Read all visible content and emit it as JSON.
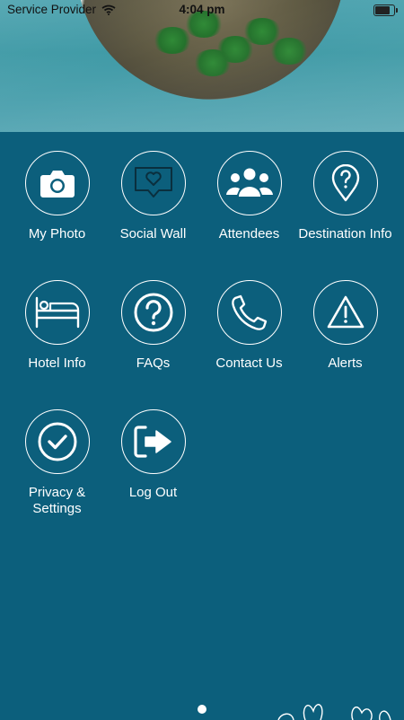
{
  "status_bar": {
    "carrier": "Service Provider",
    "time": "4:04 pm",
    "battery_level": 0.9
  },
  "hero": {
    "image": "tropical-island-aerial"
  },
  "menu": [
    {
      "label": "My Photo",
      "icon": "camera-icon"
    },
    {
      "label": "Social Wall",
      "icon": "speech-heart-icon"
    },
    {
      "label": "Attendees",
      "icon": "people-group-icon"
    },
    {
      "label": "Destination Info",
      "icon": "map-pin-question-icon"
    },
    {
      "label": "Hotel Info",
      "icon": "bed-icon"
    },
    {
      "label": "FAQs",
      "icon": "question-circle-icon"
    },
    {
      "label": "Contact Us",
      "icon": "phone-icon"
    },
    {
      "label": "Alerts",
      "icon": "warning-triangle-icon"
    },
    {
      "label": "Privacy & Settings",
      "icon": "check-circle-icon"
    },
    {
      "label": "Log Out",
      "icon": "logout-icon"
    }
  ],
  "pager": {
    "current": 1,
    "total": 1
  },
  "colors": {
    "background": "#0c5f7c",
    "foreground": "#ffffff"
  }
}
